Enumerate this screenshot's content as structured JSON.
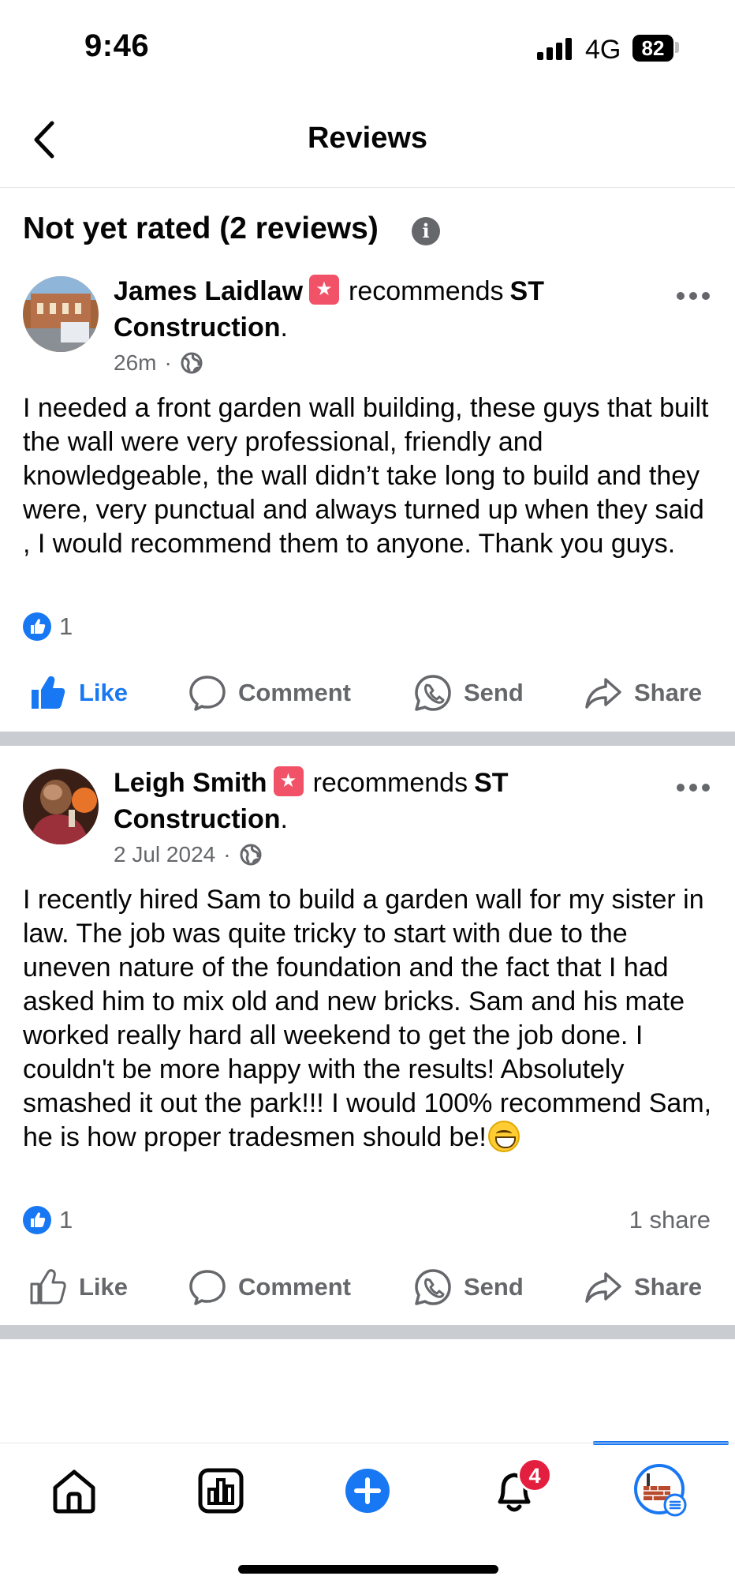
{
  "status_bar": {
    "time": "9:46",
    "network": "4G",
    "battery": "82"
  },
  "header": {
    "title": "Reviews"
  },
  "section": {
    "title": "Not yet rated (2 reviews)"
  },
  "reviews": [
    {
      "author": "James Laidlaw",
      "recommends": "recommends",
      "page": "ST Construction",
      "page_suffix": ".",
      "time": "26m",
      "separator": "·",
      "text": "I needed a front garden wall building, these guys that built the wall were very professional, friendly and knowledgeable, the wall didn’t take long to build and they were, very punctual and always turned up when they said , I would recommend them to anyone. Thank you guys.",
      "reaction_count": "1",
      "shares": "",
      "liked": true
    },
    {
      "author": "Leigh Smith",
      "recommends": "recommends",
      "page": "ST Construction",
      "page_suffix": ".",
      "time": "2 Jul 2024",
      "separator": "·",
      "text": "I recently hired Sam to build a garden wall for my sister in law. The job was quite tricky to start with due to the uneven nature of the foundation and the fact that I had asked him to mix old and new bricks. Sam and his mate worked really hard all weekend to get the job done. I couldn't be more happy with the results! Absolutely smashed it out the park!!! I would 100% recommend Sam, he is how proper tradesmen should be!",
      "reaction_count": "1",
      "shares": "1 share",
      "liked": false
    }
  ],
  "actions": {
    "like": "Like",
    "comment": "Comment",
    "send": "Send",
    "share": "Share"
  },
  "bottom_nav": {
    "notifications_badge": "4"
  },
  "colors": {
    "accent": "#1877f2",
    "muted": "#65676b",
    "badge": "#e41e3f",
    "divider": "#c9ccd1"
  }
}
